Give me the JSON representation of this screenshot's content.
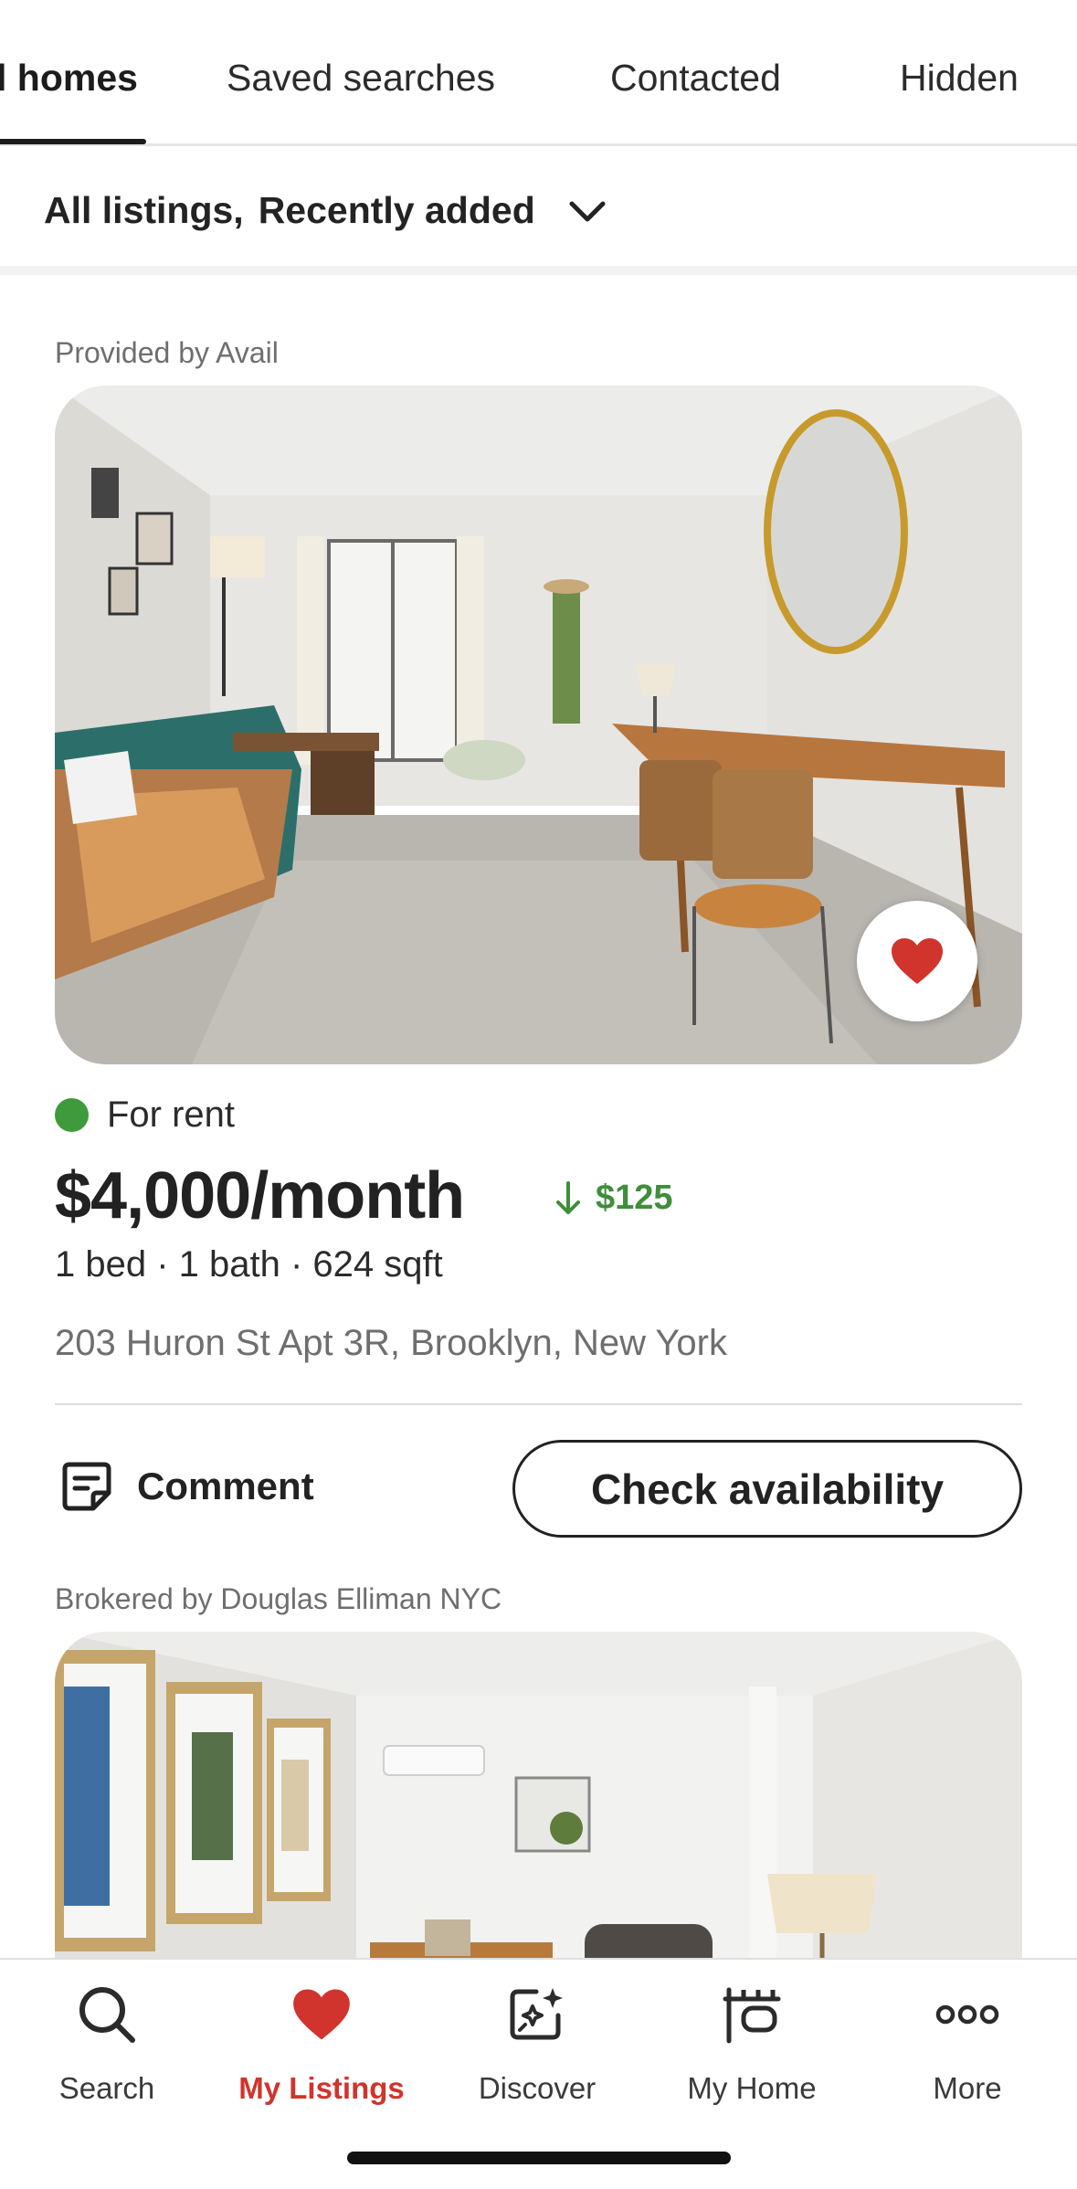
{
  "tabs": [
    {
      "label": "l homes",
      "active": true
    },
    {
      "label": "Saved searches",
      "active": false
    },
    {
      "label": "Contacted",
      "active": false
    },
    {
      "label": "Hidden",
      "active": false
    }
  ],
  "filter": {
    "scope": "All listings,",
    "sort": "Recently added"
  },
  "listings": [
    {
      "provider": "Provided by Avail",
      "saved": true,
      "status": "For rent",
      "status_color": "#3e9a3a",
      "price": "$4,000/month",
      "price_change": "$125",
      "price_change_direction": "down",
      "specs": "1 bed · 1 bath · 624 sqft",
      "address": "203 Huron St Apt 3R, Brooklyn, New York",
      "comment_label": "Comment",
      "cta_label": "Check availability"
    },
    {
      "provider": "Brokered by Douglas Elliman NYC"
    }
  ],
  "bottom_nav": [
    {
      "label": "Search",
      "icon": "search-icon",
      "active": false
    },
    {
      "label": "My Listings",
      "icon": "heart-icon",
      "active": true
    },
    {
      "label": "Discover",
      "icon": "discover-icon",
      "active": false
    },
    {
      "label": "My Home",
      "icon": "my-home-icon",
      "active": false
    },
    {
      "label": "More",
      "icon": "more-icon",
      "active": false
    }
  ],
  "colors": {
    "accent_red": "#d0342c",
    "price_drop_green": "#3e8e3a"
  }
}
